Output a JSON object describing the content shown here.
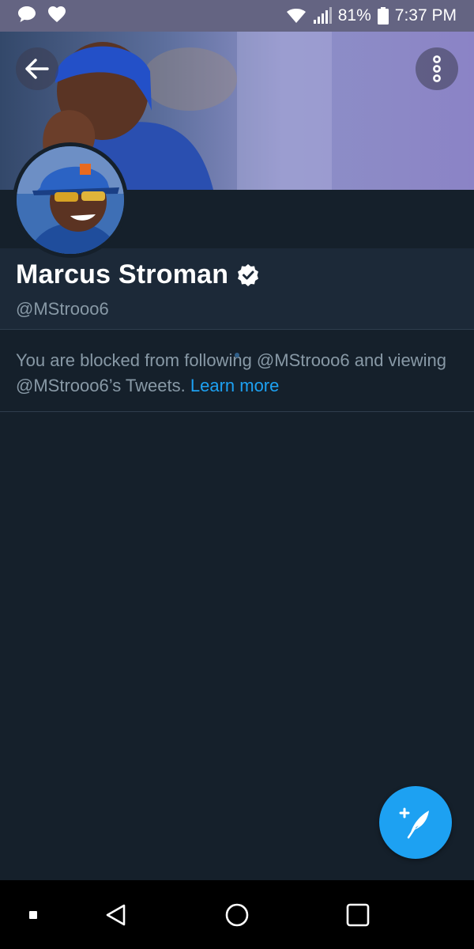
{
  "status_bar": {
    "battery_percent": "81%",
    "time": "7:37 PM",
    "icons": [
      "chat-bubble-icon",
      "heart-icon",
      "wifi-icon",
      "signal-icon",
      "battery-icon"
    ]
  },
  "header": {
    "back_icon": "arrow-left-icon",
    "more_icon": "more-vertical-icon"
  },
  "profile": {
    "display_name": "Marcus Stroman",
    "verified": true,
    "handle": "@MStrooo6"
  },
  "blocked_notice": {
    "text": "You are blocked from following @MStrooo6 and viewing @MStrooo6’s Tweets.",
    "link_label": "Learn more"
  },
  "fab": {
    "icon": "compose-tweet-icon"
  },
  "nav_bar": {
    "icons": [
      "recent-apps-dot-icon",
      "back-triangle-icon",
      "home-circle-icon",
      "overview-square-icon"
    ]
  },
  "colors": {
    "background": "#15202b",
    "profile_block": "#1c2938",
    "accent": "#1da1f2",
    "secondary_text": "#8899a6",
    "status_bar": "#646482"
  }
}
